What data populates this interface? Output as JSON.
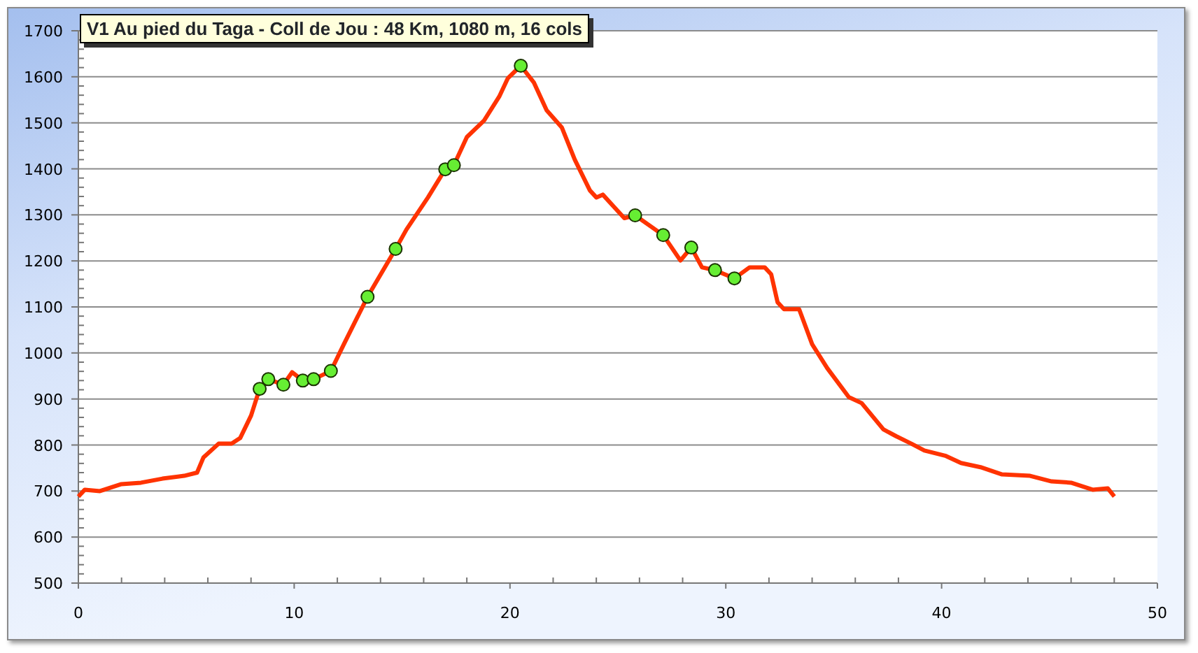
{
  "chart": {
    "chart_data": {
      "type": "line",
      "title": "V1 Au pied du Taga - Coll de Jou : 48 Km, 1080 m, 16 cols",
      "x": [
        0,
        0.3,
        1,
        2,
        2.9,
        3.9,
        4.9,
        5.5,
        5.8,
        6.5,
        7.1,
        7.5,
        8,
        8.4,
        8.8,
        9.5,
        9.9,
        10.4,
        10.9,
        11.7,
        12.3,
        13.4,
        14.7,
        15.2,
        16.2,
        17,
        17.4,
        18,
        18.8,
        19.5,
        19.9,
        20.5,
        21.1,
        21.7,
        22.4,
        23,
        23.7,
        24,
        24.3,
        25,
        25.3,
        25.8,
        27.1,
        27.9,
        28.4,
        28.9,
        29.5,
        30.4,
        31.1,
        31.8,
        32.1,
        32.4,
        32.7,
        33.4,
        34,
        34.7,
        35.7,
        36.3,
        37.3,
        37.9,
        38.6,
        39.2,
        40.2,
        40.9,
        41.8,
        42.8,
        44.1,
        45.1,
        46,
        47,
        47.7,
        48
      ],
      "series": [
        {
          "color": "#ff3300",
          "values": [
            688,
            703,
            700,
            715,
            718,
            727,
            733,
            740,
            773,
            803,
            803,
            815,
            864,
            922,
            943,
            931,
            958,
            940,
            943,
            961,
            1019,
            1122,
            1226,
            1268,
            1338,
            1399,
            1408,
            1469,
            1505,
            1557,
            1597,
            1624,
            1588,
            1527,
            1490,
            1420,
            1353,
            1338,
            1344,
            1308,
            1293,
            1299,
            1256,
            1201,
            1229,
            1186,
            1180,
            1162,
            1186,
            1186,
            1171,
            1110,
            1095,
            1095,
            1019,
            967,
            904,
            891,
            834,
            819,
            803,
            788,
            776,
            761,
            752,
            736,
            733,
            721,
            718,
            703,
            706,
            688
          ]
        },
        {
          "color": "#66ee33",
          "type": "scatter",
          "values": [
            null,
            null,
            null,
            null,
            null,
            null,
            null,
            null,
            null,
            null,
            null,
            null,
            null,
            922,
            943,
            931,
            null,
            940,
            943,
            961,
            null,
            1122,
            1226,
            null,
            null,
            1399,
            1408,
            null,
            null,
            null,
            null,
            1624,
            null,
            null,
            null,
            null,
            null,
            null,
            null,
            null,
            null,
            1299,
            1256,
            null,
            1229,
            null,
            1180,
            1162,
            null,
            null,
            null,
            null,
            null,
            null,
            null,
            null,
            null,
            null,
            null,
            null,
            null,
            null,
            null,
            null,
            null,
            null,
            null,
            null,
            null,
            null,
            null,
            null
          ]
        }
      ],
      "grid": true,
      "xlim": [
        0,
        50
      ],
      "ylim": [
        500,
        1700
      ],
      "xticks": [
        0,
        10,
        20,
        30,
        40,
        50
      ],
      "yticks": [
        500,
        600,
        700,
        800,
        900,
        1000,
        1100,
        1200,
        1300,
        1400,
        1500,
        1600,
        1700
      ]
    }
  }
}
